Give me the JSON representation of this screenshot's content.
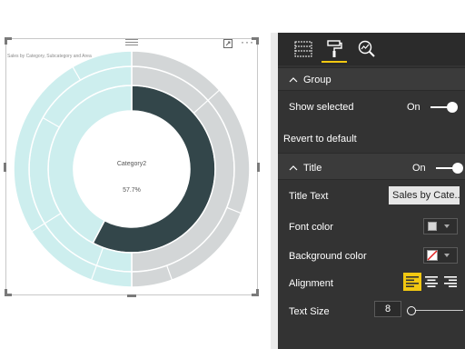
{
  "visual": {
    "title": "Sales by Category, Subcategory and Area",
    "more_label": "···"
  },
  "chart_data": {
    "type": "pie",
    "title": "Sales by Category, Subcategory and Area",
    "center_label": "Category2",
    "center_value": "57.7%",
    "rings": [
      {
        "name": "inner",
        "slices": [
          {
            "label": "Category2",
            "value": 57.7,
            "color": "#33464a"
          },
          {
            "label": "",
            "value": 42.3,
            "color": "#cdeeee"
          }
        ]
      },
      {
        "name": "middle",
        "slices": [
          {
            "label": "",
            "value": 50,
            "color": "#d3d6d7"
          },
          {
            "label": "",
            "value": 50,
            "color": "#cdeeee"
          }
        ]
      },
      {
        "name": "outer",
        "slices": [
          {
            "label": "",
            "value": 50,
            "color": "#d3d6d7"
          },
          {
            "label": "",
            "value": 50,
            "color": "#cdeeee"
          }
        ]
      }
    ]
  },
  "pane": {
    "tabs": [
      {
        "icon": "fields-icon",
        "active": false
      },
      {
        "icon": "format-paint-roller-icon",
        "active": true
      },
      {
        "icon": "analytics-magnifier-icon",
        "active": false
      }
    ],
    "group_section": {
      "label": "Group"
    },
    "show_selected": {
      "label": "Show selected",
      "state": "On"
    },
    "revert": {
      "label": "Revert to default"
    },
    "title_section": {
      "label": "Title",
      "state": "On"
    },
    "title_text": {
      "label": "Title Text",
      "value": "Sales by Cate..."
    },
    "font_color": {
      "label": "Font color",
      "color": "#d6d6d6"
    },
    "background_color": {
      "label": "Background color",
      "color": "none"
    },
    "alignment": {
      "label": "Alignment",
      "options": [
        "left",
        "center",
        "right"
      ],
      "selected": "left"
    },
    "text_size": {
      "label": "Text Size",
      "value": "8"
    }
  },
  "colors": {
    "accent": "#f2c811",
    "pane_bg": "#333333",
    "dark_slice": "#33464a",
    "light_teal": "#cdeeee",
    "light_gray": "#d3d6d7"
  }
}
